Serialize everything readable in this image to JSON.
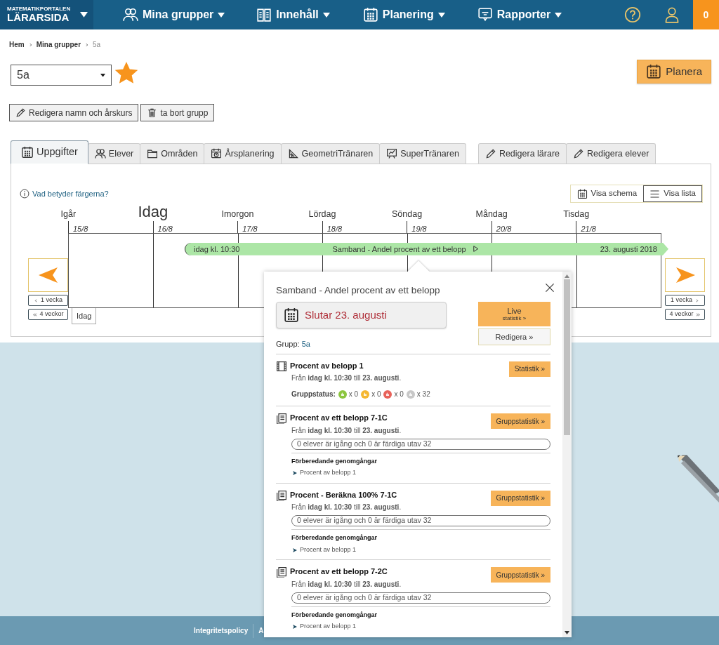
{
  "brand": {
    "top": "MATEMATIKPORTALEN",
    "name": "LÄRARSIDA"
  },
  "nav": [
    {
      "label": "Mina grupper"
    },
    {
      "label": "Innehåll"
    },
    {
      "label": "Planering"
    },
    {
      "label": "Rapporter"
    }
  ],
  "notification_count": "0",
  "breadcrumb": [
    {
      "label": "Hem",
      "current": false
    },
    {
      "label": "Mina grupper",
      "current": false
    },
    {
      "label": "5a",
      "current": true
    }
  ],
  "group_select": {
    "value": "5a"
  },
  "favorite": true,
  "plan_button": "Planera",
  "group_actions": [
    "Redigera namn och årskurs",
    "ta bort grupp"
  ],
  "tabs": [
    {
      "label": "Uppgifter",
      "selected": true
    },
    {
      "label": "Elever",
      "selected": false
    },
    {
      "label": "Områden",
      "selected": false
    },
    {
      "label": "Årsplanering",
      "selected": false
    },
    {
      "label": "GeometriTränaren",
      "selected": false
    },
    {
      "label": "SuperTränaren",
      "selected": false
    }
  ],
  "edit_tabs": [
    {
      "label": "Redigera lärare",
      "selected": false
    },
    {
      "label": "Redigera elever",
      "selected": false
    }
  ],
  "legend_link": "Vad betyder färgerna?",
  "view_toggle": [
    {
      "label": "Visa schema",
      "selected": false
    },
    {
      "label": "Visa lista",
      "selected": true
    }
  ],
  "timeline": {
    "days": [
      {
        "label": "Igår",
        "date": "15/8",
        "today": false
      },
      {
        "label": "Idag",
        "date": "16/8",
        "today": true
      },
      {
        "label": "Imorgon",
        "date": "17/8",
        "today": false
      },
      {
        "label": "Lördag",
        "date": "18/8",
        "today": false
      },
      {
        "label": "Söndag",
        "date": "19/8",
        "today": false
      },
      {
        "label": "Måndag",
        "date": "20/8",
        "today": false
      },
      {
        "label": "Tisdag",
        "date": "21/8",
        "today": false
      }
    ],
    "back": [
      "1 vecka",
      "4 veckor"
    ],
    "forward": [
      "1 vecka",
      "4 veckor"
    ],
    "today_button": "Idag",
    "event": {
      "start": "idag kl. 10:30",
      "title": "Samband - Andel procent av ett belopp",
      "end": "23. augusti 2018"
    }
  },
  "popup": {
    "title": "Samband - Andel procent av ett belopp",
    "end_label": "Slutar 23. augusti",
    "live": {
      "label": "Live",
      "sub": "statistik »"
    },
    "edit": "Redigera »",
    "group_label": "Grupp:",
    "group_value": "5a",
    "items": [
      {
        "kind": "video",
        "title": "Procent av belopp 1",
        "period": "Från **idag kl. 10:30** till **23. augusti**.",
        "button": "Statistik »",
        "status_label": "Gruppstatus:",
        "statuses": [
          {
            "color": "#8cc63f",
            "count": "x 0"
          },
          {
            "color": "#f5b731",
            "count": "x 0"
          },
          {
            "color": "#e8625a",
            "count": "x 0"
          },
          {
            "color": "#c8c8c8",
            "count": "x 32"
          }
        ]
      },
      {
        "kind": "document",
        "title": "Procent av ett belopp 7-1C",
        "period": "Från **idag kl. 10:30** till **23. augusti**.",
        "button": "Gruppstatistik »",
        "progress": "0 elever är igång och 0 är färdiga utav 32",
        "level": 0,
        "prep_title": "Förberedande genomgångar",
        "prep_links": [
          "Procent av belopp 1"
        ]
      },
      {
        "kind": "document",
        "title": "Procent - Beräkna 100% 7-1C",
        "period": "Från **idag kl. 10:30** till **23. augusti**.",
        "button": "Gruppstatistik »",
        "progress": "0 elever är igång och 0 är färdiga utav 32",
        "level": 0,
        "prep_title": "Förberedande genomgångar",
        "prep_links": [
          "Procent av belopp 1"
        ]
      },
      {
        "kind": "document",
        "title": "Procent av ett belopp 7-2C",
        "period": "Från **idag kl. 10:30** till **23. augusti**.",
        "button": "Gruppstatistik »",
        "progress": "0 elever är igång och 0 är färdiga utav 32",
        "level": 0,
        "prep_title": "Förberedande genomgångar",
        "prep_links": [
          "Procent av belopp 1"
        ]
      }
    ]
  },
  "footer": [
    "Integritetspolicy",
    "A"
  ]
}
